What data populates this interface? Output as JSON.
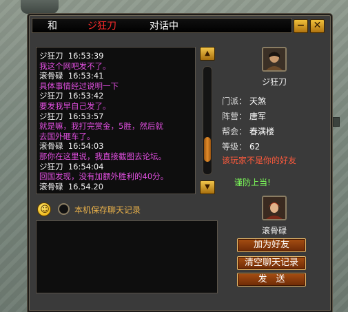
{
  "window": {
    "title_left": "和",
    "title_name": "ジ狂刀",
    "title_suffix": "对话中",
    "minimize_label": "−",
    "close_label": "✕",
    "colors": {
      "title_name": "#ff2b2b",
      "message_body": "#e14fe0",
      "warning": "#ff5a3c",
      "guard": "#7dff5a"
    }
  },
  "chat": {
    "messages": [
      {
        "sender": "ジ狂刀",
        "time": "16:53:39",
        "lines": [
          "我这个网吧发不了。"
        ]
      },
      {
        "sender": "滚骨碌",
        "time": "16:53:41",
        "lines": [
          "具体事情经过说明一下"
        ]
      },
      {
        "sender": "ジ狂刀",
        "time": "16:53:42",
        "lines": [
          "要发我早自己发了。"
        ]
      },
      {
        "sender": "ジ狂刀",
        "time": "16:53:57",
        "lines": [
          "就是嘛，我打完赏金，5胜，然后就",
          "去国外砸车了。"
        ]
      },
      {
        "sender": "滚骨碌",
        "time": "16:54:03",
        "lines": [
          "那你在这里说，我直接截图去论坛。"
        ]
      },
      {
        "sender": "ジ狂刀",
        "time": "16:54:04",
        "lines": [
          "回国发现，没有加额外胜利的40分。"
        ]
      },
      {
        "sender": "滚骨碌",
        "time": "16.54.20",
        "lines": []
      }
    ]
  },
  "scroll": {
    "up_icon": "triangle-up-icon",
    "down_icon": "triangle-down-icon",
    "position_fraction": 0.85
  },
  "target": {
    "name": "ジ狂刀",
    "info": [
      {
        "label": "门派：",
        "value": "天煞"
      },
      {
        "label": "阵营：",
        "value": "唐军"
      },
      {
        "label": "帮会：",
        "value": "春满楼"
      },
      {
        "label": "等级：",
        "value": "62"
      }
    ],
    "warning": "该玩家不是你的好友",
    "guard": "谨防上当!"
  },
  "self": {
    "name": "滚骨碌"
  },
  "options": {
    "save_history_label": "本机保存聊天记录"
  },
  "buttons": {
    "add_friend": "加为好友",
    "clear_history": "清空聊天记录",
    "send": "发　送"
  }
}
